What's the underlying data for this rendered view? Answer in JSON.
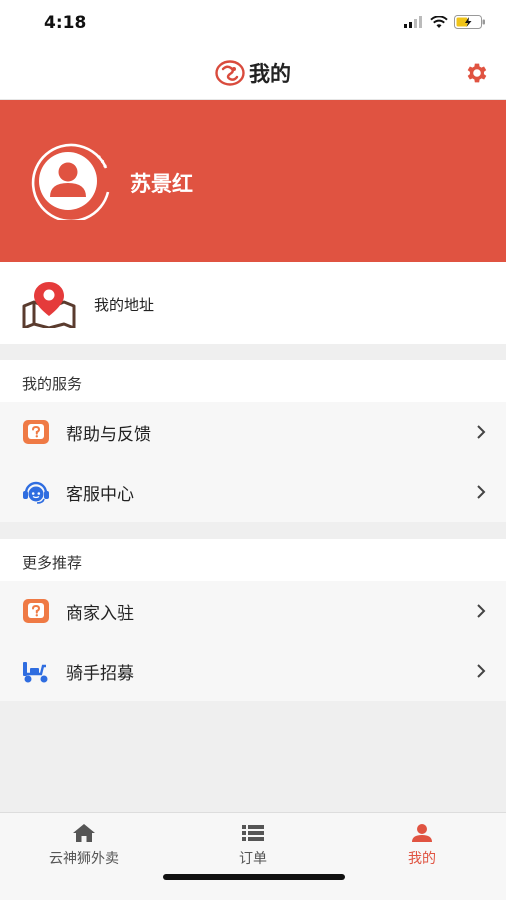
{
  "status_bar": {
    "time": "4:18"
  },
  "nav": {
    "title": "我的"
  },
  "profile": {
    "name": "苏景红"
  },
  "address": {
    "label": "我的地址"
  },
  "services": {
    "title": "我的服务",
    "items": [
      {
        "label": "帮助与反馈",
        "icon": "help-icon"
      },
      {
        "label": "客服中心",
        "icon": "customer-service-icon"
      }
    ]
  },
  "recommend": {
    "title": "更多推荐",
    "items": [
      {
        "label": "商家入驻",
        "icon": "merchant-icon"
      },
      {
        "label": "骑手招募",
        "icon": "scooter-icon"
      }
    ]
  },
  "tabs": [
    {
      "label": "云神狮外卖",
      "icon": "home-icon",
      "active": false
    },
    {
      "label": "订单",
      "icon": "list-icon",
      "active": false
    },
    {
      "label": "我的",
      "icon": "user-icon",
      "active": true
    }
  ],
  "colors": {
    "accent": "#e05341",
    "orange": "#ef7a45",
    "blue": "#2f6de0"
  }
}
